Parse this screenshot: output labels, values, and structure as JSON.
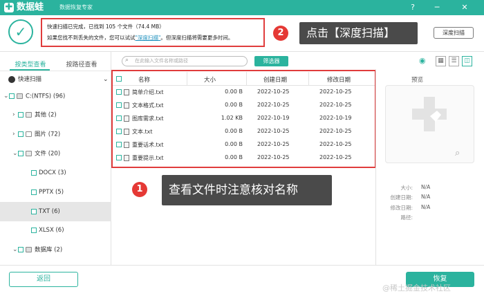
{
  "app": {
    "title": "数据蛙",
    "subtitle": "数据恢复专家"
  },
  "window_controls": {
    "help": "?",
    "minimize": "─",
    "close": "✕"
  },
  "status": {
    "line1": "快速扫描已完成，已找到 105 个文件（74.4 MB）",
    "line2_pre": "如果您找不到丢失的文件，您可以试试",
    "line2_link": "\"深度扫描\"",
    "line2_post": "。但深度扫描将需要更多时间。"
  },
  "deep_scan_button": "深度扫描",
  "annotations": {
    "step2_number": "2",
    "step2_text": "点击【深度扫描】",
    "step1_number": "1",
    "step1_text": "查看文件时注意核对名称"
  },
  "left_tabs": {
    "by_type": "按类型查看",
    "by_path": "按路径查看"
  },
  "tree": {
    "quick_scan": "快速扫描",
    "items": [
      {
        "label": "C:(NTFS) (96)"
      },
      {
        "label": "其他 (2)"
      },
      {
        "label": "图片 (72)"
      },
      {
        "label": "文件 (20)"
      },
      {
        "label": "DOCX (3)"
      },
      {
        "label": "PPTX (5)"
      },
      {
        "label": "TXT (6)"
      },
      {
        "label": "XLSX (6)"
      },
      {
        "label": "数据库 (2)"
      }
    ]
  },
  "search": {
    "placeholder": "在此输入文件名称或路径"
  },
  "filter_button": "筛选器",
  "table": {
    "headers": {
      "name": "名称",
      "size": "大小",
      "created": "创建日期",
      "modified": "修改日期"
    },
    "rows": [
      {
        "name": "简单介绍.txt",
        "size": "0.00 B",
        "created": "2022-10-25",
        "modified": "2022-10-25"
      },
      {
        "name": "文本格式.txt",
        "size": "0.00 B",
        "created": "2022-10-25",
        "modified": "2022-10-25"
      },
      {
        "name": "图库需求.txt",
        "size": "1.02 KB",
        "created": "2022-10-19",
        "modified": "2022-10-19"
      },
      {
        "name": "文本.txt",
        "size": "0.00 B",
        "created": "2022-10-25",
        "modified": "2022-10-25"
      },
      {
        "name": "重要话术.txt",
        "size": "0.00 B",
        "created": "2022-10-25",
        "modified": "2022-10-25"
      },
      {
        "name": "重要提示.txt",
        "size": "0.00 B",
        "created": "2022-10-25",
        "modified": "2022-10-25"
      }
    ]
  },
  "preview": {
    "title": "预览",
    "fields": [
      {
        "label": "大小:",
        "value": "N/A"
      },
      {
        "label": "创建日期:",
        "value": "N/A"
      },
      {
        "label": "修改日期:",
        "value": "N/A"
      },
      {
        "label": "路径:",
        "value": ""
      }
    ]
  },
  "footer": {
    "back": "返回",
    "recover": "恢复",
    "watermark": "@稀土掘金技术社区"
  },
  "colors": {
    "accent": "#2bb39e",
    "annotation_red": "#e03c3c",
    "callout_bg": "#4a4a4a"
  },
  "icons": [
    "logo-icon",
    "help-icon",
    "minimize-icon",
    "close-icon",
    "check-circle-icon",
    "search-icon",
    "eye-icon",
    "grid-view-icon",
    "list-view-icon",
    "detail-view-icon",
    "drive-icon",
    "folder-icon",
    "image-icon",
    "database-icon",
    "file-icon",
    "magnifier-icon"
  ]
}
